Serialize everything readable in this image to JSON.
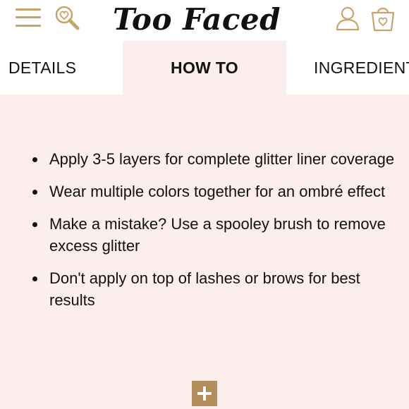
{
  "header": {
    "logo_text": "Too Faced",
    "icons": {
      "menu": "hamburger-menu-icon",
      "search": "heart-magnifier-search-icon",
      "account": "user-account-icon",
      "bag": "shopping-bag-icon"
    },
    "accent_color": "#c9a46a"
  },
  "tabs": [
    {
      "label": "DETAILS",
      "active": false
    },
    {
      "label": "HOW TO",
      "active": true
    },
    {
      "label": "INGREDIENTS",
      "active": false
    }
  ],
  "howto": {
    "items": [
      "Apply 3-5 layers for complete glitter liner coverage",
      "Wear multiple colors together for an ombré effect",
      "Make a mistake? Use a spooley brush to remove excess glitter",
      "Don't apply on top of lashes or brows for best results"
    ],
    "expand_icon": "plus-icon",
    "panel_color": "#fdeeee",
    "button_color": "#b58d5a"
  }
}
